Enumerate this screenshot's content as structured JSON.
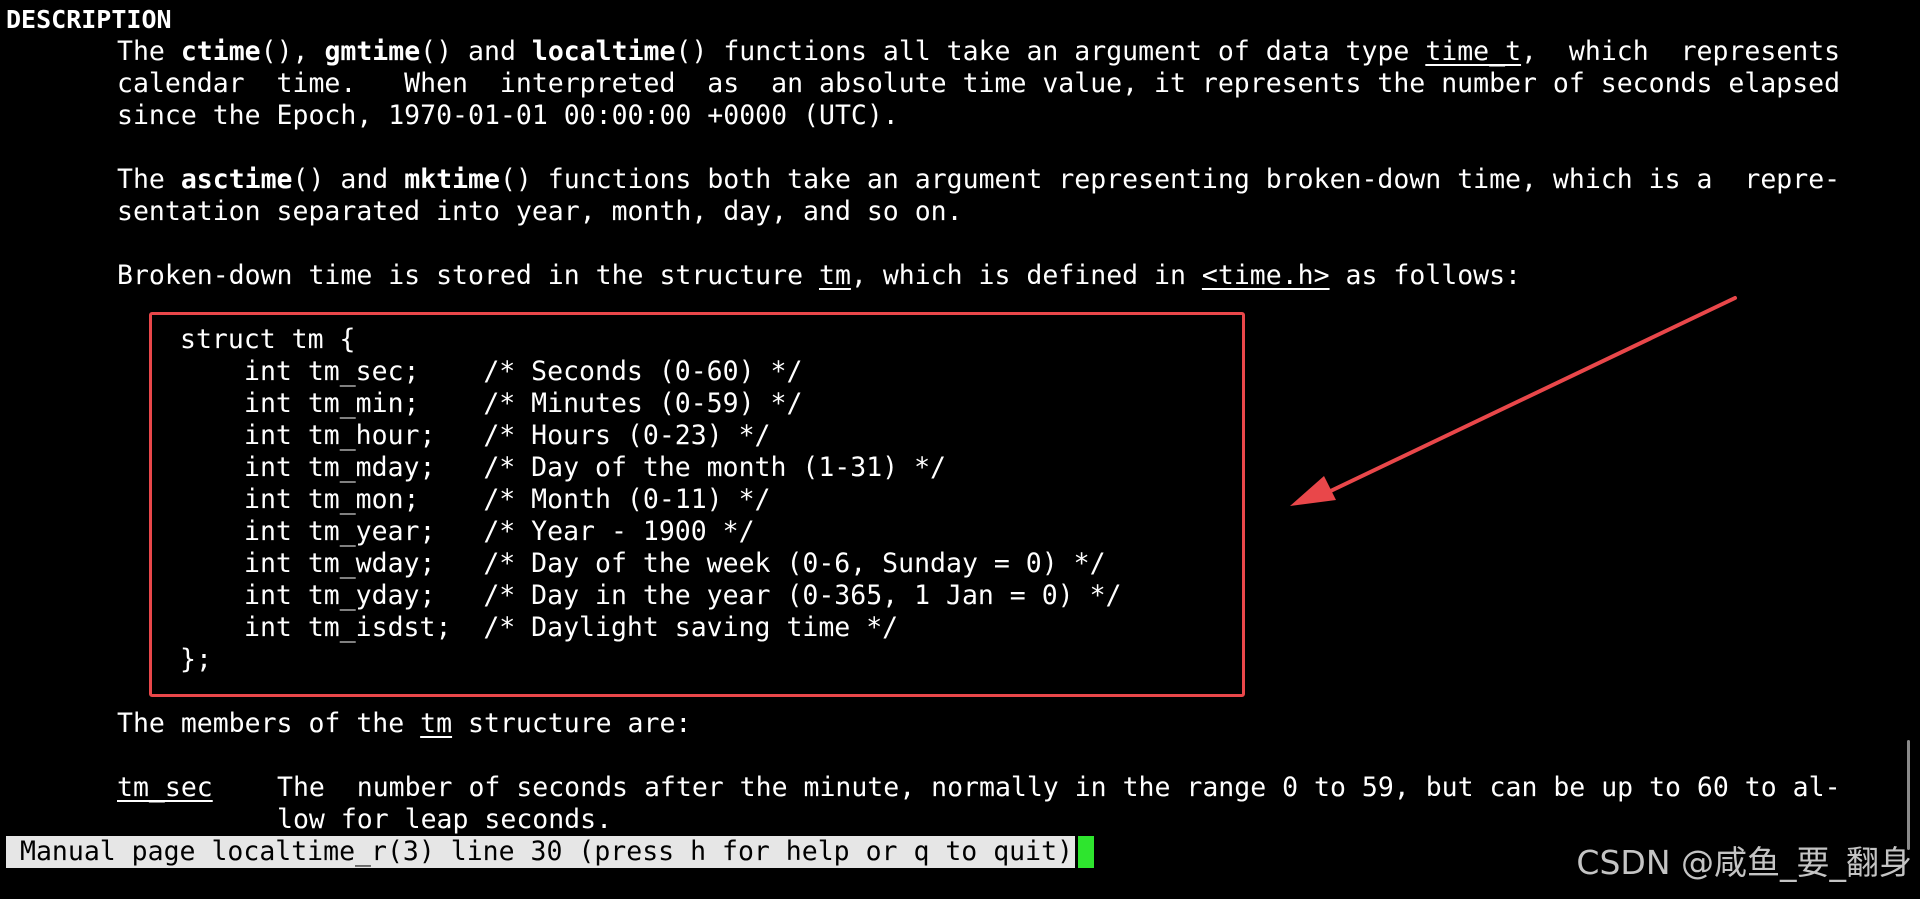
{
  "man": {
    "section": "DESCRIPTION",
    "p1": {
      "l1a": "The ",
      "ctime": "ctime",
      "l1b": "(), ",
      "gmtime": "gmtime",
      "l1c": "() and ",
      "localtime": "localtime",
      "l1d": "() functions all take an argument of data type ",
      "time_t": "time_t",
      "l1e": ",  which  represents",
      "l2": "calendar  time.   When  interpreted  as  an absolute time value, it represents the number of seconds elapsed",
      "l3": "since the Epoch, 1970-01-01 00:00:00 +0000 (UTC)."
    },
    "p2": {
      "l1a": "The ",
      "asctime": "asctime",
      "l1b": "() and ",
      "mktime": "mktime",
      "l1c": "() functions both take an argument representing broken-down time, which is a  repre-",
      "l2": "sentation separated into year, month, day, and so on."
    },
    "p3": {
      "a": "Broken-down time is stored in the structure ",
      "tm": "tm",
      "b": ", which is defined in ",
      "header": "<time.h>",
      "c": " as follows:"
    },
    "struct": {
      "open": "struct tm {",
      "fields": [
        "int tm_sec;    /* Seconds (0-60) */",
        "int tm_min;    /* Minutes (0-59) */",
        "int tm_hour;   /* Hours (0-23) */",
        "int tm_mday;   /* Day of the month (1-31) */",
        "int tm_mon;    /* Month (0-11) */",
        "int tm_year;   /* Year - 1900 */",
        "int tm_wday;   /* Day of the week (0-6, Sunday = 0) */",
        "int tm_yday;   /* Day in the year (0-365, 1 Jan = 0) */",
        "int tm_isdst;  /* Daylight saving time */"
      ],
      "close": "};"
    },
    "p4": {
      "a": "The members of the ",
      "tm": "tm",
      "b": " structure are:"
    },
    "p5": {
      "term": "tm_sec",
      "l1": "The  number of seconds after the minute, normally in the range 0 to 59, but can be up to 60 to al-",
      "l2": "low for leap seconds."
    }
  },
  "status_bar": {
    "text": "Manual page localtime_r(3) line 30 (press h for help or q to quit)"
  },
  "watermark": {
    "text": "CSDN @咸鱼_要_翻身"
  },
  "colors": {
    "annotation": "#e9474a",
    "cursor": "#2ee52e",
    "background": "#000000",
    "text": "#ffffff"
  }
}
